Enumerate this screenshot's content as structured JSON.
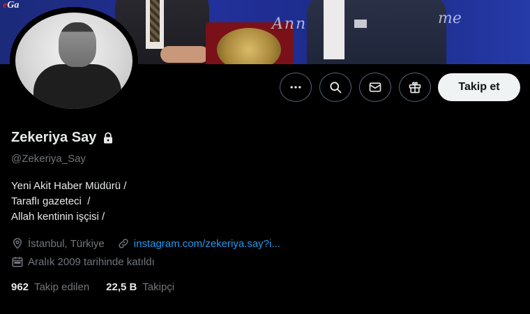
{
  "banner": {
    "logo_fragment": "Ga",
    "script_text_left": "Ann",
    "script_text_right": "me"
  },
  "actions": {
    "more_icon": "ellipsis-icon",
    "search_icon": "search-icon",
    "message_icon": "mail-icon",
    "gift_icon": "gift-icon",
    "follow_label": "Takip et"
  },
  "profile": {
    "display_name": "Zekeriya Say",
    "protected_icon": "lock-icon",
    "handle": "@Zekeriya_Say",
    "bio_lines": [
      "Yeni Akit Haber Müdürü /",
      "Taraflı gazeteci  /",
      "Allah kentinin işçisi /"
    ],
    "location": "İstanbul, Türkiye",
    "website": "instagram.com/zekeriya.say?i...",
    "joined": "Aralık 2009 tarihinde katıldı"
  },
  "stats": {
    "following_count": "962",
    "following_label": "Takip edilen",
    "followers_count": "22,5 B",
    "followers_label": "Takipçi"
  },
  "colors": {
    "background": "#000000",
    "link": "#1d9bf0",
    "muted": "#71767b",
    "follow_button_bg": "#eff3f4"
  }
}
